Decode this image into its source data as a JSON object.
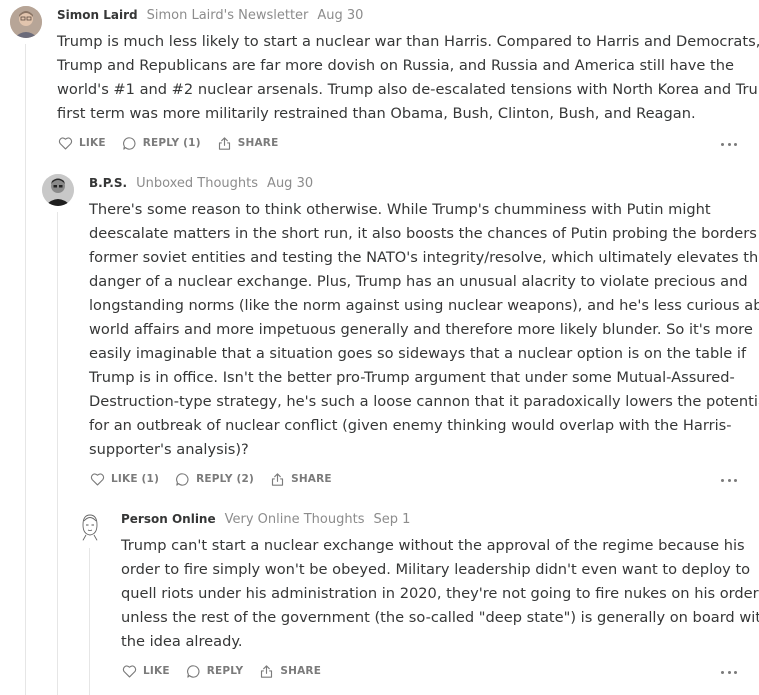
{
  "comments": [
    {
      "author": "Simon Laird",
      "publication": "Simon Laird's Newsletter",
      "date": "Aug 30",
      "lines": [
        "Trump is much less likely to start a nuclear war than Harris. Compared to Harris and Democrats,",
        "Trump and Republicans are far more dovish on Russia, and Russia and America still have the",
        "world's #1 and #2 nuclear arsenals. Trump also de-escalated tensions with North Korea and Trump's",
        "first term was more militarily restrained than Obama, Bush, Clinton, Bush, and Reagan."
      ],
      "like_label": "LIKE",
      "reply_label": "REPLY (1)",
      "share_label": "SHARE"
    },
    {
      "author": "B.P.S.",
      "publication": "Unboxed Thoughts",
      "date": "Aug 30",
      "lines": [
        "There's some reason to think otherwise. While Trump's chumminess with Putin might",
        "deescalate matters in the short run, it also boosts the chances of Putin probing the borders of",
        "former soviet entities and testing the NATO's integrity/resolve, which ultimately elevates the",
        "danger of a nuclear exchange. Plus, Trump has an unusual alacrity to violate precious and",
        "longstanding norms (like the norm against using nuclear weapons), and he's less curious about",
        "world affairs and more impetuous generally and therefore more likely blunder. So it's more",
        "easily imaginable that a situation goes so sideways that a nuclear option is on the table if",
        "Trump is in office. Isn't the better pro-Trump argument that under some Mutual-Assured-",
        "Destruction-type strategy, he's such a loose cannon that it paradoxically lowers the potential",
        "for an outbreak of nuclear conflict (given enemy thinking would overlap with the Harris-",
        "supporter's analysis)?"
      ],
      "like_label": "LIKE (1)",
      "reply_label": "REPLY (2)",
      "share_label": "SHARE"
    },
    {
      "author": "Person Online",
      "publication": "Very Online Thoughts",
      "date": "Sep 1",
      "lines": [
        "Trump can't start a nuclear exchange without the approval of the regime because his",
        "order to fire simply won't be obeyed. Military leadership didn't even want to deploy to",
        "quell riots under his administration in 2020, they're not going to fire nukes on his order",
        "unless the rest of the government (the so-called \"deep state\") is generally on board with",
        "the idea already."
      ],
      "like_label": "LIKE",
      "reply_label": "REPLY",
      "share_label": "SHARE"
    }
  ],
  "icons": {
    "like": "heart-icon",
    "reply": "speech-bubble-icon",
    "share": "share-icon",
    "more": "ellipsis-icon"
  }
}
